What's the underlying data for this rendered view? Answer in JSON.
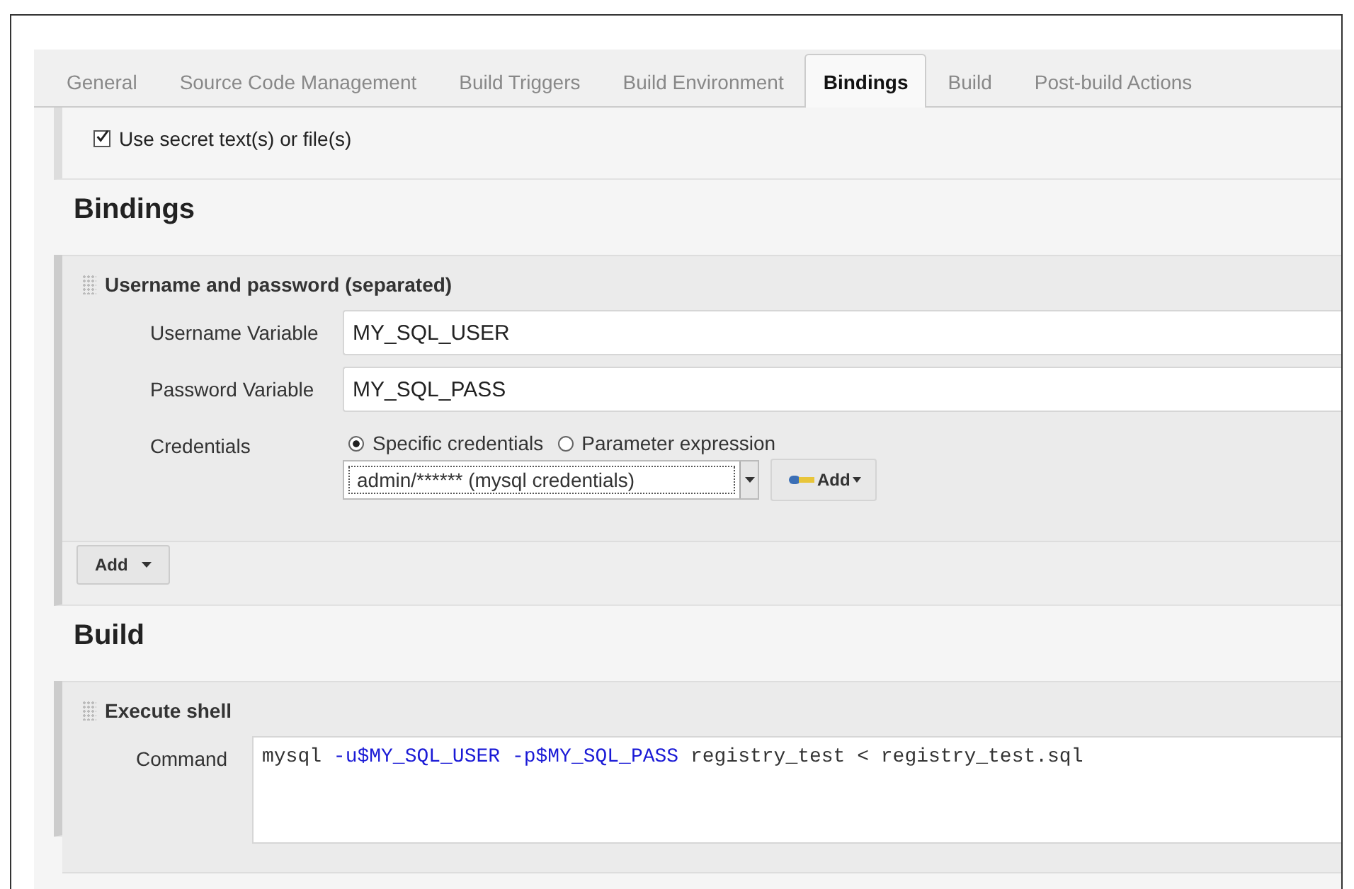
{
  "tabs": [
    {
      "label": "General",
      "selected": false
    },
    {
      "label": "Source Code Management",
      "selected": false
    },
    {
      "label": "Build Triggers",
      "selected": false
    },
    {
      "label": "Build Environment",
      "selected": false
    },
    {
      "label": "Bindings",
      "selected": true
    },
    {
      "label": "Build",
      "selected": false
    },
    {
      "label": "Post-build Actions",
      "selected": false
    }
  ],
  "secret_option": {
    "label": "Use secret text(s) or file(s)",
    "checked": true
  },
  "bindings": {
    "heading": "Bindings",
    "binding": {
      "title": "Username and password (separated)",
      "username": {
        "label": "Username Variable",
        "value": "MY_SQL_USER"
      },
      "password": {
        "label": "Password Variable",
        "value": "MY_SQL_PASS"
      },
      "credentials": {
        "label": "Credentials",
        "options": [
          {
            "label": "Specific credentials",
            "selected": true
          },
          {
            "label": "Parameter expression",
            "selected": false
          }
        ],
        "select_value": "admin/****** (mysql credentials)",
        "add_button": "Add"
      }
    },
    "add_button": "Add"
  },
  "build": {
    "heading": "Build",
    "step": {
      "title": "Execute shell",
      "label": "Command",
      "command": [
        {
          "text": "mysql ",
          "kind": "plain"
        },
        {
          "text": "-u$MY_SQL_USER",
          "kind": "option"
        },
        {
          "text": " -p$MY_SQL_PASS",
          "kind": "option"
        },
        {
          "text": " registry_test < registry_test.sql",
          "kind": "plain"
        }
      ]
    }
  }
}
